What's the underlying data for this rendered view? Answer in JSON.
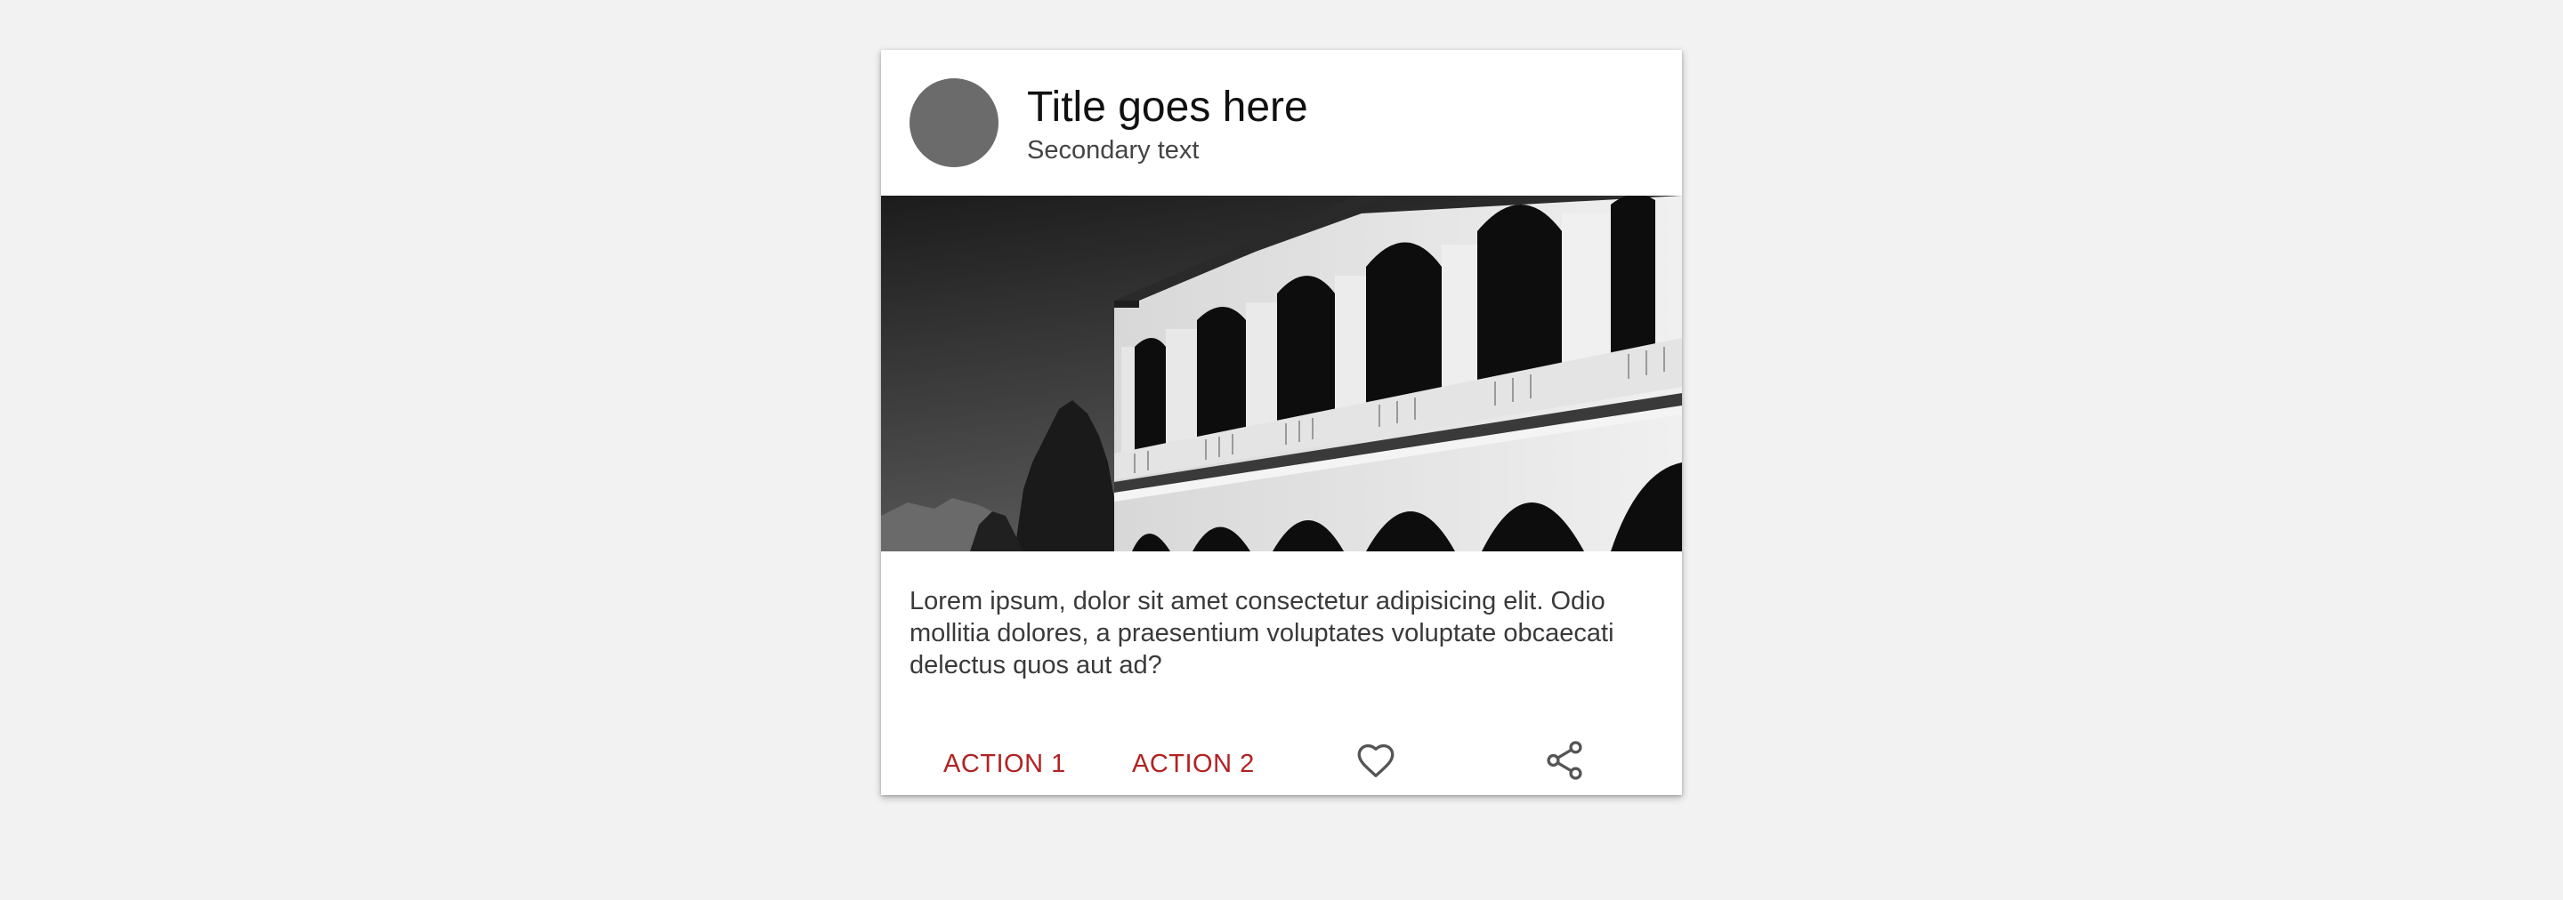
{
  "card": {
    "title": "Title goes here",
    "secondary": "Secondary text",
    "body": "Lorem ipsum, dolor sit amet consectetur adipisicing elit. Odio mollitia dolores, a praesentium voluptates voluptate obcaecati delectus quos aut ad?",
    "actions": {
      "action1_label": "ACTION 1",
      "action2_label": "ACTION 2",
      "favorite_icon": "heart-outline",
      "share_icon": "share"
    }
  },
  "colors": {
    "background": "#f2f2f2",
    "card": "#ffffff",
    "avatar": "#6b6b6b",
    "action": "#b22222",
    "icon": "#555555"
  }
}
